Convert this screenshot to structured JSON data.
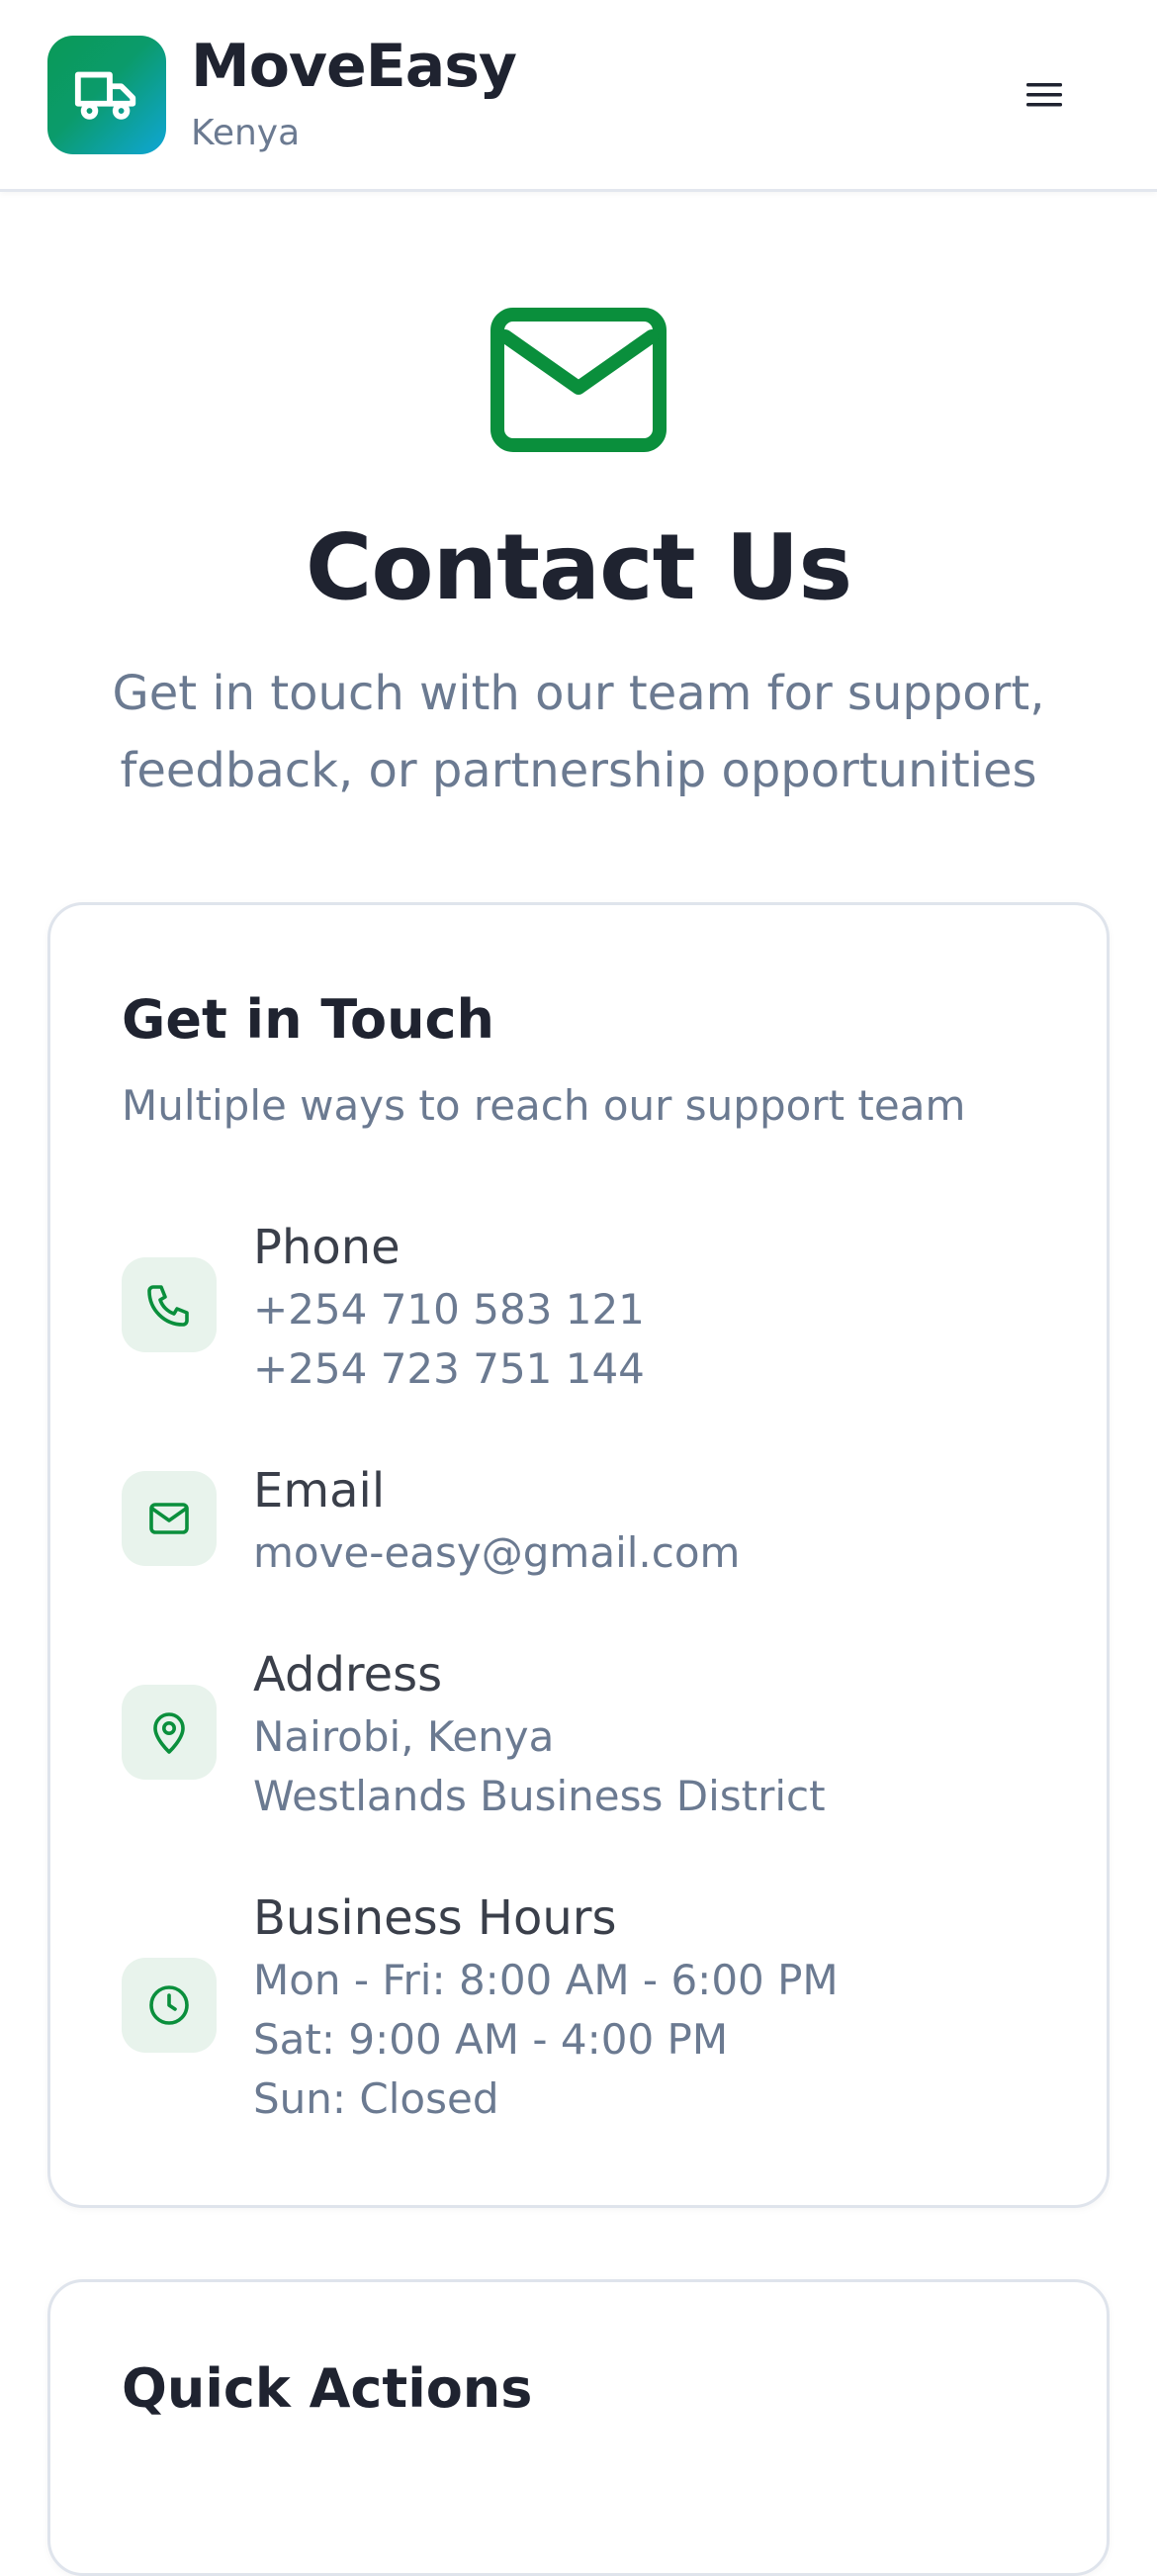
{
  "header": {
    "brand_name": "MoveEasy",
    "brand_sub": "Kenya",
    "logo_icon": "truck-icon",
    "menu_icon": "menu-icon"
  },
  "hero": {
    "icon": "mail-icon",
    "title": "Contact Us",
    "subtitle": "Get in touch with our team for support, feedback, or partnership opportunities"
  },
  "contact_card": {
    "title": "Get in Touch",
    "subtitle": "Multiple ways to reach our support team",
    "items": [
      {
        "icon": "phone-icon",
        "label": "Phone",
        "lines": [
          "+254 710 583 121",
          "+254 723 751 144"
        ]
      },
      {
        "icon": "mail-icon",
        "label": "Email",
        "lines": [
          "move-easy@gmail.com"
        ]
      },
      {
        "icon": "map-pin-icon",
        "label": "Address",
        "lines": [
          "Nairobi, Kenya",
          "Westlands Business District"
        ]
      },
      {
        "icon": "clock-icon",
        "label": "Business Hours",
        "lines": [
          "Mon - Fri: 8:00 AM - 6:00 PM",
          "Sat: 9:00 AM - 4:00 PM",
          "Sun: Closed"
        ]
      }
    ]
  },
  "quick_actions": {
    "title": "Quick Actions"
  },
  "colors": {
    "brand_green": "#0a8f3c",
    "text_dark": "#1f2330",
    "text_muted": "#6b7a91",
    "icon_bg": "#e8f3ec"
  }
}
